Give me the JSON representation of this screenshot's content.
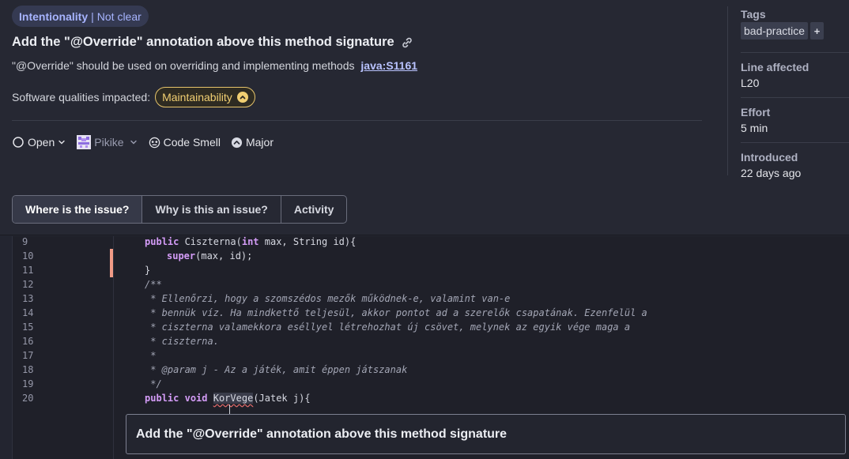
{
  "header": {
    "clean_code": {
      "attribute": "Intentionality",
      "separator": "|",
      "category": "Not clear"
    },
    "title": "Add the \"@Override\" annotation above this method signature",
    "description": "\"@Override\" should be used on overriding and implementing methods",
    "rule_link": "java:S1161",
    "qualities_label": "Software qualities impacted:",
    "quality_chip": "Maintainability",
    "meta": {
      "status": "Open",
      "assignee": "Pikike",
      "type": "Code Smell",
      "severity": "Major"
    }
  },
  "side": {
    "tags_label": "Tags",
    "tag": "bad-practice",
    "tag_add": "+",
    "line_label": "Line affected",
    "line_value": "L20",
    "effort_label": "Effort",
    "effort_value": "5 min",
    "introduced_label": "Introduced",
    "introduced_value": "22 days ago"
  },
  "tabs": [
    "Where is the issue?",
    "Why is this an issue?",
    "Activity"
  ],
  "code": {
    "line_numbers": [
      "9",
      "10",
      "11",
      "12",
      "13",
      "14",
      "15",
      "16",
      "17",
      "18",
      "19",
      "20"
    ],
    "lines": {
      "l9_kw": "public",
      "l9_rest": " Ciszterna(",
      "l9_kw2": "int",
      "l9_rest2": " max, String id){",
      "l10_kw": "super",
      "l10_rest": "(max, id);",
      "l11": "}",
      "l12": "/**",
      "l13": " * Ellenőrzi, hogy a szomszédos mezők működnek-e, valamint van-e",
      "l14": " * bennük víz. Ha mindkettő teljesül, akkor pontot ad a szerelők csapatának. Ezenfelül a",
      "l15": " * ciszterna valamekkora eséllyel létrehozhat új csövet, melynek az egyik vége maga a",
      "l16": " * ciszterna.",
      "l17": " *",
      "l18": " * @param j - Az a játék, amit éppen játszanak",
      "l19": " */",
      "l20_kw1": "public",
      "l20_kw2": "void",
      "l20_method": "KorVege",
      "l20_rest": "(Jatek j){"
    }
  },
  "tooltip": "Add the \"@Override\" annotation above this method signature",
  "colors": {
    "background": "#232530",
    "accent": "#a7b4ff",
    "maintainability": "#f1cf72",
    "keyword": "#d49cf7",
    "issue_marker": "#f19b86"
  },
  "icons": [
    "link-icon",
    "status-circle-icon",
    "chevron-down-icon",
    "avatar-icon",
    "code-smell-icon",
    "severity-major-icon",
    "chevron-up-icon"
  ]
}
